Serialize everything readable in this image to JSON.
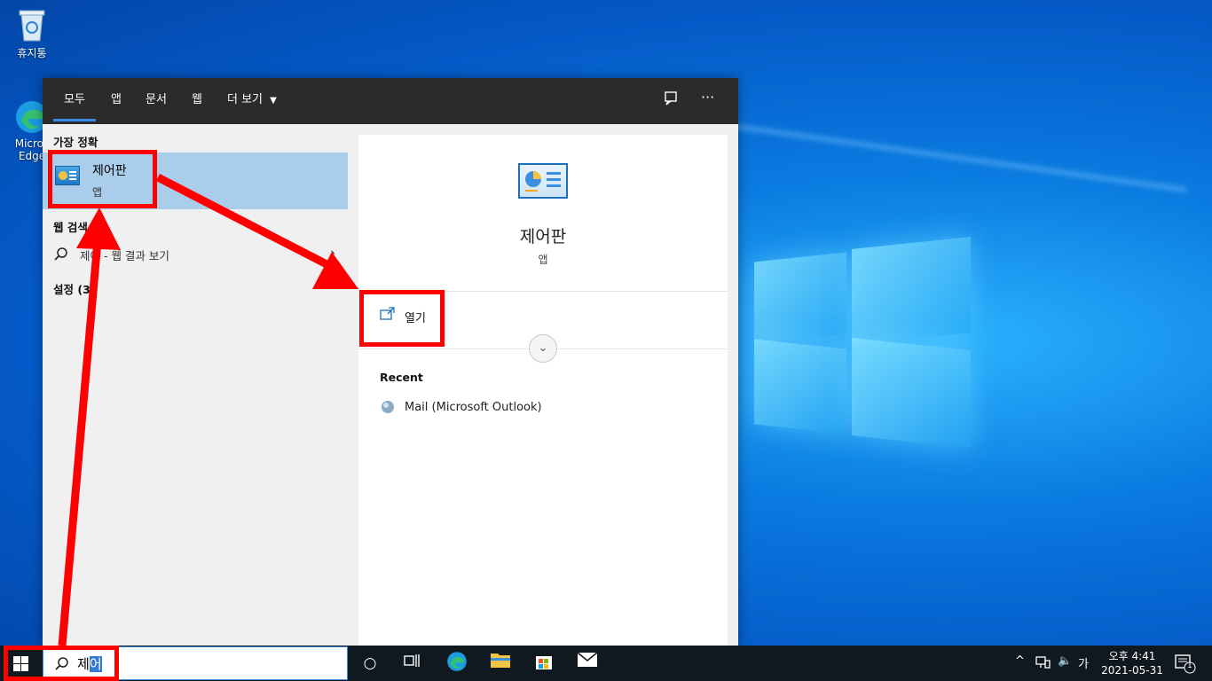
{
  "desktop": {
    "recycle_bin_label": "휴지통",
    "edge_label_line1": "Micros",
    "edge_label_line2": "Edge"
  },
  "search_panel": {
    "tabs": [
      "모두",
      "앱",
      "문서",
      "웹",
      "더 보기"
    ],
    "best_match_header": "가장 정확",
    "best_match": {
      "title": "제어판",
      "type": "앱"
    },
    "web_search_header": "웹 검색",
    "web_search_item": "제어 - 웹 결과 보기",
    "settings_header": "설정 (3)",
    "detail": {
      "title": "제어판",
      "type": "앱",
      "open_label": "열기",
      "recent_header": "Recent",
      "recent_items": [
        "Mail (Microsoft Outlook)"
      ]
    }
  },
  "taskbar": {
    "search_prefix": "제",
    "search_selected": "어",
    "ime_indicator": "가",
    "time": "오후 4:41",
    "date": "2021-05-31",
    "notification_count": "1"
  },
  "colors": {
    "annotation": "#ff0000",
    "selection": "#aacdeb",
    "accent": "#3a8be6"
  }
}
